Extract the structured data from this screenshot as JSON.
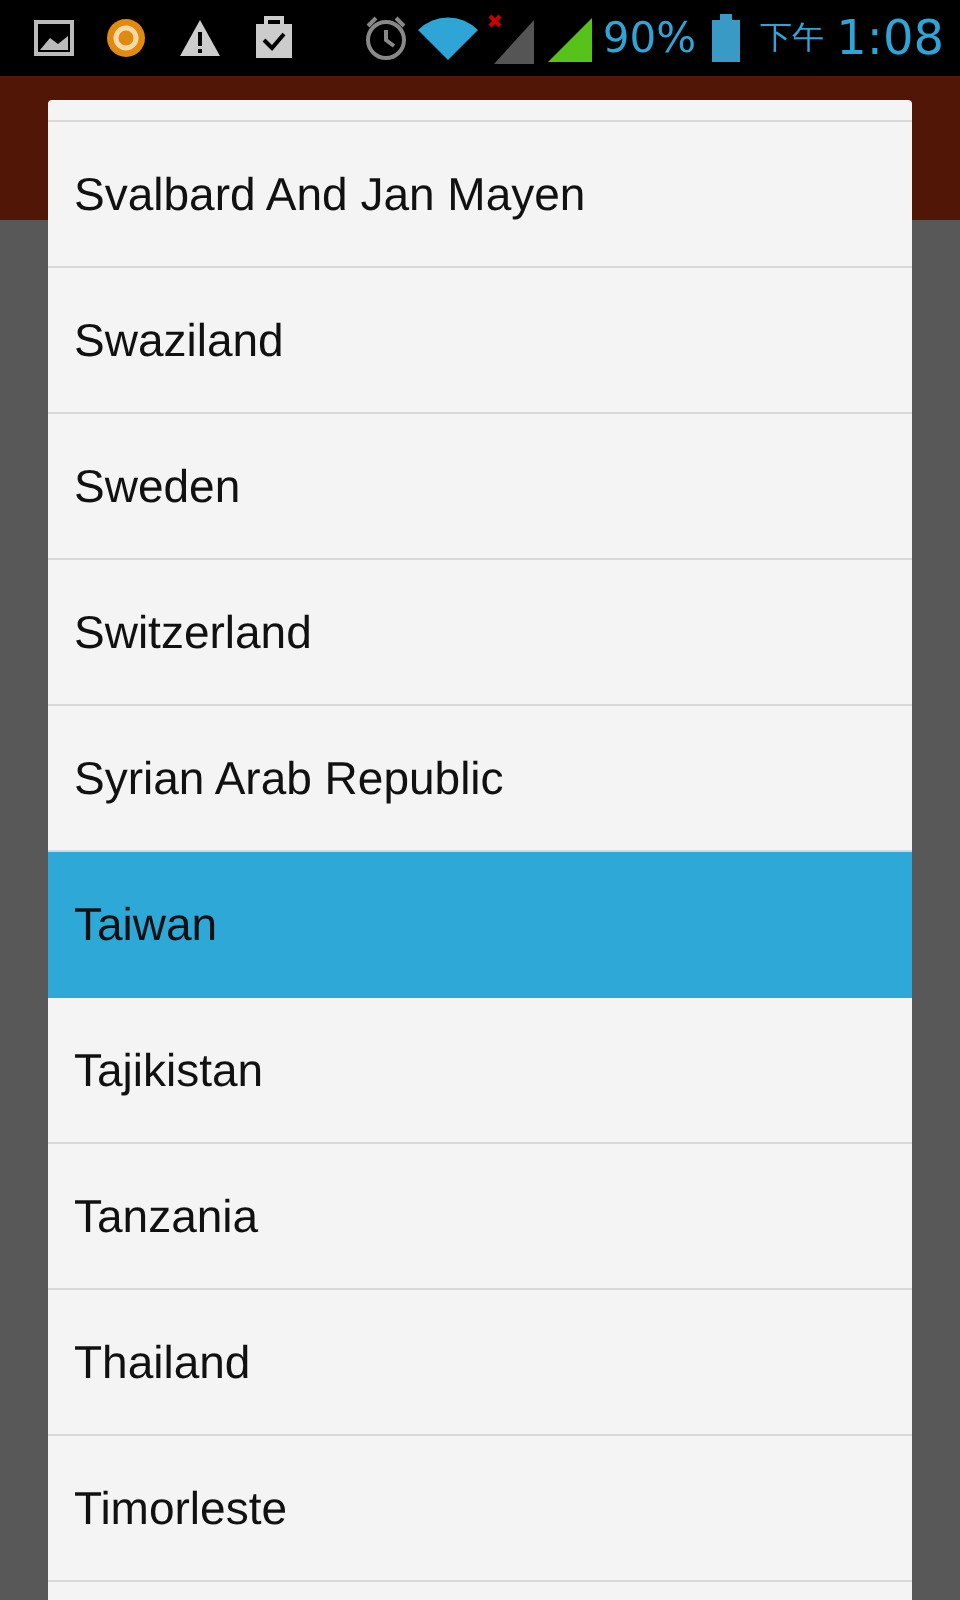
{
  "status_bar": {
    "battery": "90%",
    "period": "下午",
    "time": "1:08"
  },
  "countries": [
    {
      "label": "Svalbard And Jan Mayen",
      "selected": false
    },
    {
      "label": "Swaziland",
      "selected": false
    },
    {
      "label": "Sweden",
      "selected": false
    },
    {
      "label": "Switzerland",
      "selected": false
    },
    {
      "label": "Syrian Arab Republic",
      "selected": false
    },
    {
      "label": "Taiwan",
      "selected": true
    },
    {
      "label": "Tajikistan",
      "selected": false
    },
    {
      "label": "Tanzania",
      "selected": false
    },
    {
      "label": "Thailand",
      "selected": false
    },
    {
      "label": "Timorleste",
      "selected": false
    }
  ]
}
